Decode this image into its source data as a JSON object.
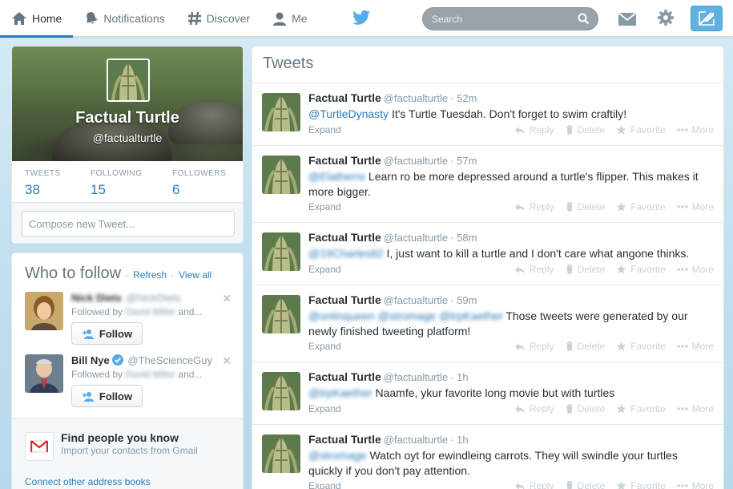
{
  "nav": {
    "items": [
      {
        "label": "Home",
        "icon": "home-icon",
        "active": true
      },
      {
        "label": "Notifications",
        "icon": "bell-icon",
        "active": false
      },
      {
        "label": "Discover",
        "icon": "hashtag-icon",
        "active": false
      },
      {
        "label": "Me",
        "icon": "user-icon",
        "active": false
      }
    ],
    "search_placeholder": "Search"
  },
  "colors": {
    "accent": "#2b7bb9",
    "background": "#c0deed",
    "compose_button": "#5fb2e0",
    "verified": "#55acee"
  },
  "profile": {
    "name": "Factual Turtle",
    "handle": "@factualturtle",
    "stats": [
      {
        "label": "TWEETS",
        "value": "38"
      },
      {
        "label": "FOLLOWING",
        "value": "15"
      },
      {
        "label": "FOLLOWERS",
        "value": "6"
      }
    ],
    "compose_placeholder": "Compose new Tweet..."
  },
  "who_to_follow": {
    "title": "Who to follow",
    "refresh": "Refresh",
    "separator": "·",
    "view_all": "View all",
    "suggestions": [
      {
        "name": "Nick Diets",
        "handle": "@NickDiets",
        "followed_by_prefix": "Followed by",
        "followed_by_name": "David Miller",
        "followed_by_suffix": "and...",
        "follow_label": "Follow"
      },
      {
        "name": "Bill Nye",
        "handle": "@TheScienceGuy",
        "followed_by_prefix": "Followed by",
        "followed_by_name": "David Miller",
        "followed_by_suffix": "and...",
        "follow_label": "Follow"
      }
    ],
    "find_title": "Find people you know",
    "find_sub": "Import your contacts from Gmail",
    "connect_link": "Connect other address books"
  },
  "stream": {
    "title": "Tweets",
    "actions": {
      "reply": "Reply",
      "delete": "Delete",
      "favorite": "Favorite",
      "more": "More",
      "expand": "Expand"
    },
    "tweets": [
      {
        "name": "Factual Turtle",
        "handle": "@factualturtle",
        "time": "· 52m",
        "mention": "@TurtleDynasty",
        "text": " It's  Turtle Tuesdah. Don't forget to swim craftily!"
      },
      {
        "name": "Factual Turtle",
        "handle": "@factualturtle",
        "time": "· 57m",
        "mention": "@Elatherre",
        "text": " Learn ro be more depressed around a turtle's flipper. This makes it more bigger."
      },
      {
        "name": "Factual Turtle",
        "handle": "@factualturtle",
        "time": "· 58m",
        "mention": "@19Charles82",
        "text": " I,  just want to kill a turtle and I don't care what angone thinks."
      },
      {
        "name": "Factual Turtle",
        "handle": "@factualturtle",
        "time": "· 59m",
        "mention": "@onlinqueen @stromage @trpKaether",
        "text": " Those tweets were generated by our newly finished tweeting platform!"
      },
      {
        "name": "Factual Turtle",
        "handle": "@factualturtle",
        "time": "· 1h",
        "mention": "@trpKaether",
        "text": " Naamfe, ykur favorite long movie but with turtles"
      },
      {
        "name": "Factual Turtle",
        "handle": "@factualturtle",
        "time": "· 1h",
        "mention": "@stromage",
        "text": " Watch oyt for ewindleing carrots. They will swindle your turtles quickly if you don't pay attention."
      }
    ]
  }
}
